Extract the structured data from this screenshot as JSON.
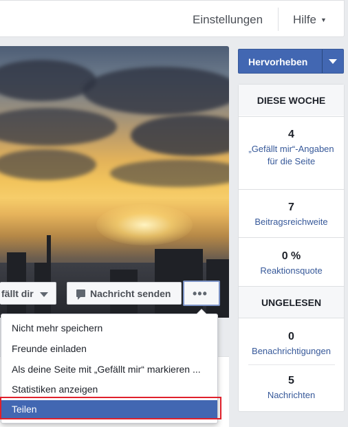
{
  "topbar": {
    "settings": "Einstellungen",
    "help": "Hilfe"
  },
  "actions": {
    "like_label": "fällt dir",
    "message_label": "Nachricht senden",
    "more_label": "•••"
  },
  "menu": {
    "items": [
      {
        "label": "Nicht mehr speichern"
      },
      {
        "label": "Freunde einladen"
      },
      {
        "label": "Als deine Seite mit „Gefällt mir“ markieren ..."
      },
      {
        "label": "Statistiken anzeigen"
      },
      {
        "label": "Teilen"
      }
    ],
    "active_index": 4
  },
  "sidebar": {
    "promote_label": "Hervorheben",
    "this_week_title": "DIESE WOCHE",
    "likes": {
      "value": "4",
      "caption": "„Gefällt mir“-Angaben für die Seite"
    },
    "reach": {
      "value": "7",
      "caption": "Beitragsreichweite"
    },
    "response": {
      "value": "0 %",
      "caption": "Reaktionsquote"
    },
    "unread_title": "UNGELESEN",
    "notifications": {
      "value": "0",
      "caption": "Benachrichtigungen"
    },
    "messages": {
      "value": "5",
      "caption": "Nachrichten"
    }
  },
  "colors": {
    "accent": "#4267b2",
    "link": "#365899",
    "highlight_border": "#e0202a"
  }
}
